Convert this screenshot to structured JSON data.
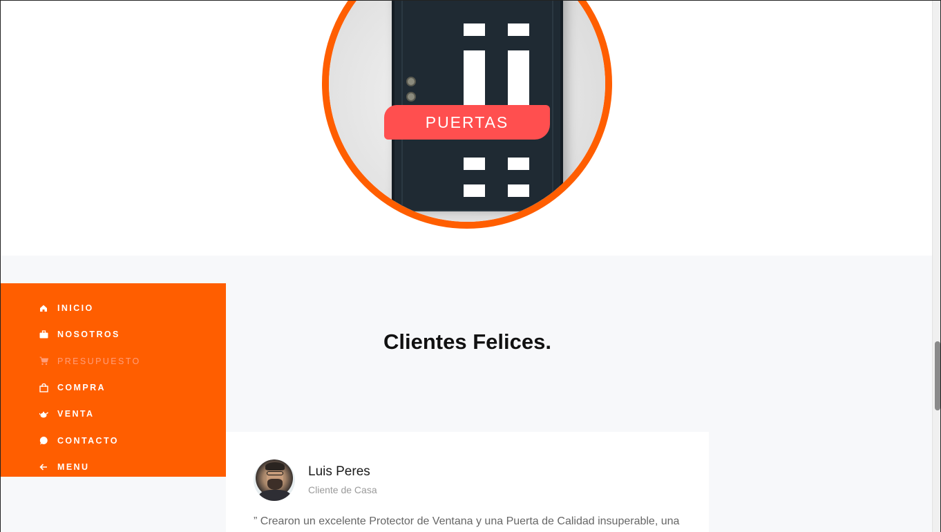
{
  "hero": {
    "badge_label": "PUERTAS"
  },
  "sidebar": {
    "items": [
      {
        "label": "INICIO",
        "icon": "home-icon",
        "active": false
      },
      {
        "label": "NOSOTROS",
        "icon": "briefcase-icon",
        "active": false
      },
      {
        "label": "PRESUPUESTO",
        "icon": "cart-icon",
        "active": true
      },
      {
        "label": "COMPRA",
        "icon": "shopping-bag-icon",
        "active": false
      },
      {
        "label": "VENTA",
        "icon": "teapot-icon",
        "active": false
      },
      {
        "label": "CONTACTO",
        "icon": "chat-icon",
        "active": false
      },
      {
        "label": "MENU",
        "icon": "arrow-left-icon",
        "active": false
      }
    ]
  },
  "testimonials": {
    "title": "Clientes Felices.",
    "items": [
      {
        "name": "Luis Peres",
        "role": "Cliente de Casa",
        "quote": "” Crearon un excelente Protector de Ventana y una Puerta de Calidad insuperable, una"
      }
    ]
  },
  "colors": {
    "accent": "#ff5e00",
    "badge": "#ff4f4f",
    "section_bg": "#f7f8fa"
  }
}
